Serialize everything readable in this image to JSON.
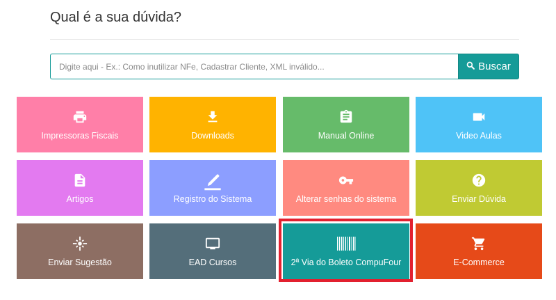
{
  "page": {
    "title": "Qual é a sua dúvida?"
  },
  "search": {
    "placeholder": "Digite aqui - Ex.: Como inutilizar NFe, Cadastrar Cliente, XML inválido...",
    "button_label": "Buscar"
  },
  "tiles": [
    {
      "label": "Impressoras Fiscais",
      "color": "#ff7fa8",
      "icon": "printer-icon"
    },
    {
      "label": "Downloads",
      "color": "#ffb300",
      "icon": "download-icon"
    },
    {
      "label": "Manual Online",
      "color": "#66bb6a",
      "icon": "clipboard-icon"
    },
    {
      "label": "Video Aulas",
      "color": "#4fc3f7",
      "icon": "video-camera-icon"
    },
    {
      "label": "Artigos",
      "color": "#e37af0",
      "icon": "document-icon"
    },
    {
      "label": "Registro do Sistema",
      "color": "#8c9eff",
      "icon": "pencil-icon"
    },
    {
      "label": "Alterar senhas do sistema",
      "color": "#ff8a80",
      "icon": "key-icon"
    },
    {
      "label": "Enviar Dúvida",
      "color": "#c0ca33",
      "icon": "help-circle-icon"
    },
    {
      "label": "Enviar Sugestão",
      "color": "#8d6e63",
      "icon": "lightbulb-icon"
    },
    {
      "label": "EAD Cursos",
      "color": "#546e7a",
      "icon": "monitor-icon"
    },
    {
      "label": "2ª Via do Boleto CompuFour",
      "color": "#159b98",
      "icon": "barcode-icon"
    },
    {
      "label": "E-Commerce",
      "color": "#e64a19",
      "icon": "shopping-cart-icon"
    }
  ],
  "highlight_color": "#e2202f"
}
